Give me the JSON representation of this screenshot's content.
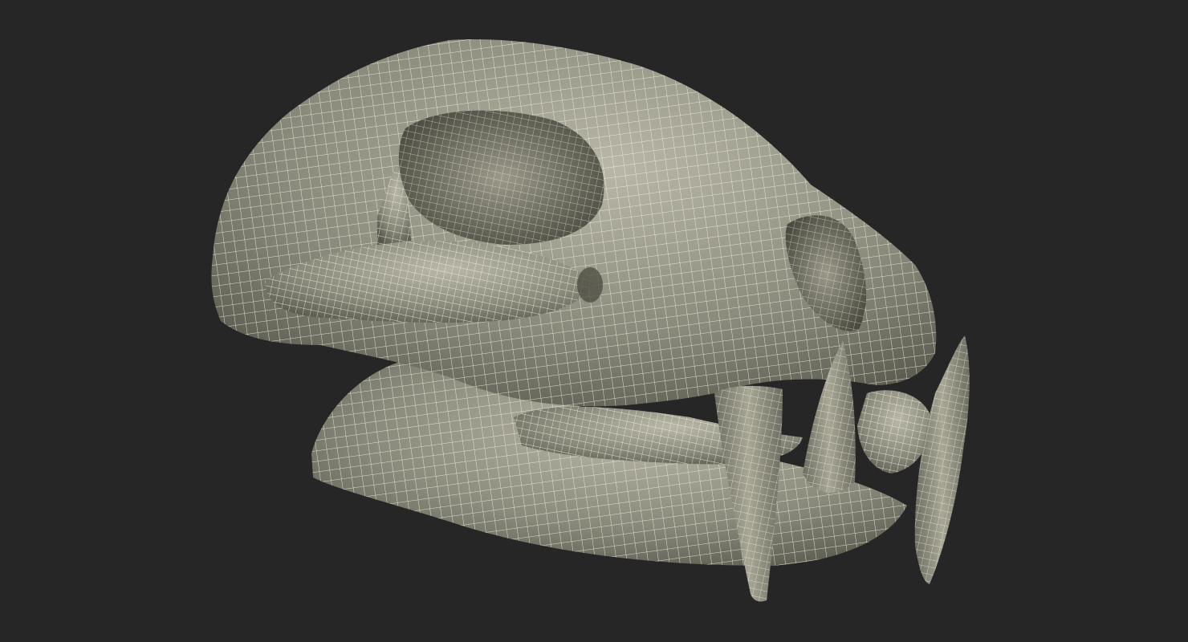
{
  "scene": {
    "background_color": "#262626",
    "model": "skull-wireframe",
    "surface_color": "#8a8a7c",
    "surface_light_color": "#b9b8a8",
    "surface_shadow_color": "#55554b",
    "wire_color": "#f2f0dc",
    "cavity_color": "#4a4a40"
  }
}
